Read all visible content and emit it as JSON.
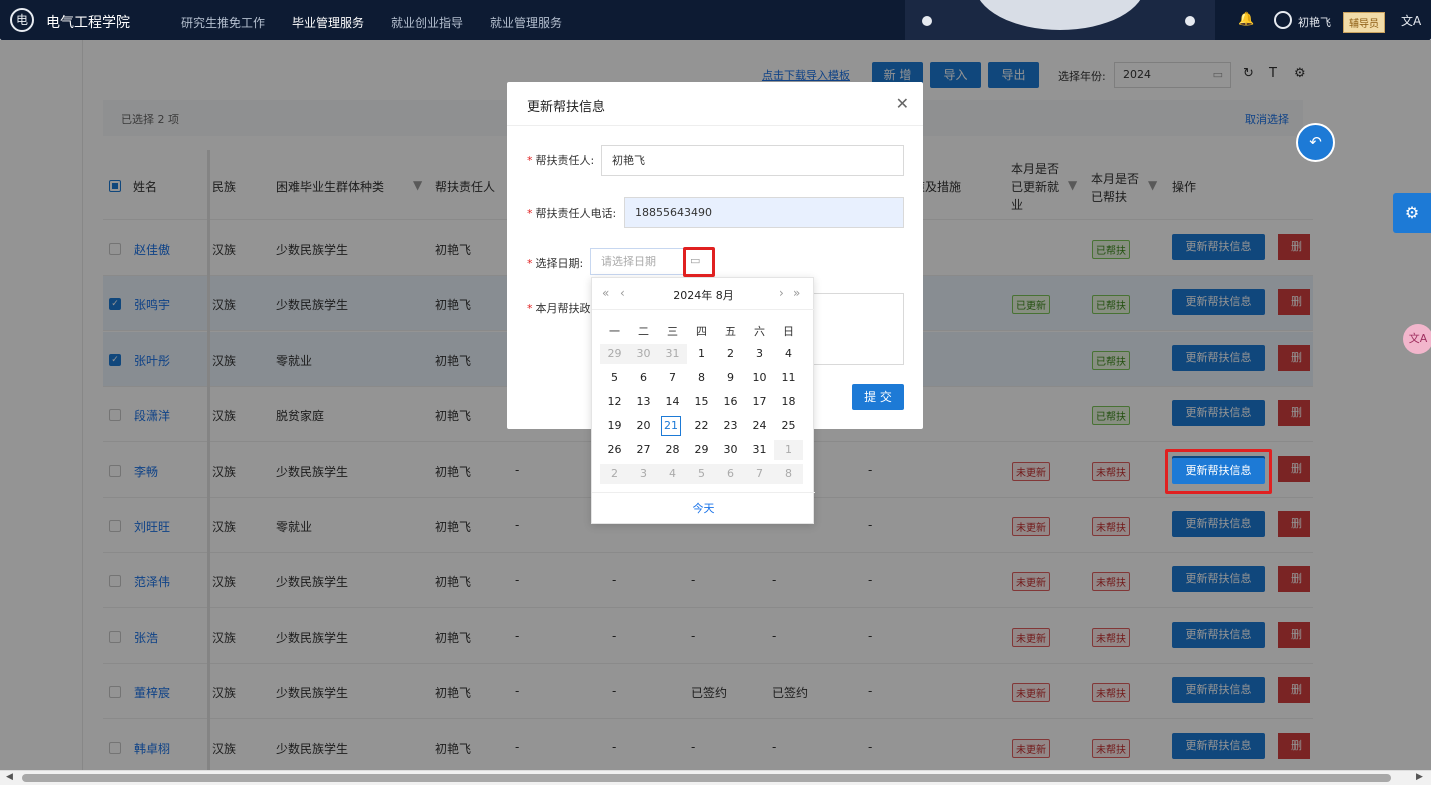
{
  "header": {
    "app_title": "电气工程学院",
    "logo_glyph": "电",
    "nav": [
      "研究生推免工作",
      "毕业管理服务",
      "就业创业指导",
      "就业管理服务"
    ],
    "active_nav_index": 1,
    "user_name": "初艳飞",
    "role_badge": "辅导员",
    "bell_glyph": "🔔",
    "lang_glyph": "文A"
  },
  "toolbar": {
    "download_template": "点击下载导入模板",
    "add_button": "新 增",
    "import_button": "导入",
    "export_button": "导出",
    "year_label": "选择年份:",
    "year_value": "2024",
    "refresh_glyph": "↻",
    "column_glyph": "T",
    "settings_glyph": "⚙"
  },
  "selection": {
    "selected_text": "已选择 2 项",
    "cancel_text": "取消选择"
  },
  "table": {
    "headers": {
      "name": "姓名",
      "ethnicity": "民族",
      "category": "困难毕业生群体种类",
      "responsible": "帮扶责任人",
      "measures": "策及措施",
      "updated": "本月是否已更新就业",
      "helped": "本月是否已帮扶",
      "actions": "操作"
    },
    "update_button": "更新帮扶信息",
    "delete_button": "删除",
    "rows": [
      {
        "name": "赵佳傲",
        "ethnicity": "汉族",
        "category": "少数民族学生",
        "responsible": "初艳飞",
        "c5": "",
        "c6": "",
        "c7": "",
        "c8": "",
        "c9": "",
        "updated": "",
        "helped": "已帮扶",
        "checked": false
      },
      {
        "name": "张鸣宇",
        "ethnicity": "汉族",
        "category": "少数民族学生",
        "responsible": "初艳飞",
        "c5": "",
        "c6": "",
        "c7": "",
        "c8": "",
        "c9": "",
        "updated": "已更新",
        "helped": "已帮扶",
        "checked": true
      },
      {
        "name": "张叶彤",
        "ethnicity": "汉族",
        "category": "零就业",
        "responsible": "初艳飞",
        "c5": "",
        "c6": "",
        "c7": "",
        "c8": "",
        "c9": "",
        "updated": "",
        "helped": "已帮扶",
        "checked": true
      },
      {
        "name": "段潇洋",
        "ethnicity": "汉族",
        "category": "脱贫家庭",
        "responsible": "初艳飞",
        "c5": "",
        "c6": "",
        "c7": "",
        "c8": "",
        "c9": "",
        "updated": "",
        "helped": "已帮扶",
        "checked": false
      },
      {
        "name": "李畅",
        "ethnicity": "汉族",
        "category": "少数民族学生",
        "responsible": "初艳飞",
        "c5": "-",
        "c6": "",
        "c7": "",
        "c8": "",
        "c9": "-",
        "updated": "未更新",
        "helped": "未帮扶",
        "checked": false
      },
      {
        "name": "刘旺旺",
        "ethnicity": "汉族",
        "category": "零就业",
        "responsible": "初艳飞",
        "c5": "-",
        "c6": "",
        "c7": "",
        "c8": "",
        "c9": "-",
        "updated": "未更新",
        "helped": "未帮扶",
        "checked": false
      },
      {
        "name": "范泽伟",
        "ethnicity": "汉族",
        "category": "少数民族学生",
        "responsible": "初艳飞",
        "c5": "-",
        "c6": "-",
        "c7": "-",
        "c8": "-",
        "c9": "-",
        "updated": "未更新",
        "helped": "未帮扶",
        "checked": false
      },
      {
        "name": "张浩",
        "ethnicity": "汉族",
        "category": "少数民族学生",
        "responsible": "初艳飞",
        "c5": "-",
        "c6": "-",
        "c7": "-",
        "c8": "-",
        "c9": "-",
        "updated": "未更新",
        "helped": "未帮扶",
        "checked": false
      },
      {
        "name": "董梓宸",
        "ethnicity": "汉族",
        "category": "少数民族学生",
        "responsible": "初艳飞",
        "c5": "-",
        "c6": "-",
        "c7": "已签约",
        "c8": "已签约",
        "c9": "-",
        "updated": "未更新",
        "helped": "未帮扶",
        "checked": false
      },
      {
        "name": "韩卓栩",
        "ethnicity": "汉族",
        "category": "少数民族学生",
        "responsible": "初艳飞",
        "c5": "-",
        "c6": "-",
        "c7": "-",
        "c8": "-",
        "c9": "-",
        "updated": "未更新",
        "helped": "未帮扶",
        "checked": false
      }
    ]
  },
  "modal": {
    "title": "更新帮扶信息",
    "close_glyph": "✕",
    "responsible_label": "帮扶责任人:",
    "responsible_value": "初艳飞",
    "phone_label": "帮扶责任人电话:",
    "phone_value": "18855643490",
    "date_label": "选择日期:",
    "date_placeholder": "请选择日期",
    "policy_label": "本月帮扶政",
    "submit_button": "提 交"
  },
  "datepicker": {
    "title": "2024年  8月",
    "prev_year": "«",
    "prev_month": "‹",
    "next_month": "›",
    "next_year": "»",
    "weekdays": [
      "一",
      "二",
      "三",
      "四",
      "五",
      "六",
      "日"
    ],
    "weeks": [
      [
        "29",
        "30",
        "31",
        "1",
        "2",
        "3",
        "4"
      ],
      [
        "5",
        "6",
        "7",
        "8",
        "9",
        "10",
        "11"
      ],
      [
        "12",
        "13",
        "14",
        "15",
        "16",
        "17",
        "18"
      ],
      [
        "19",
        "20",
        "21",
        "22",
        "23",
        "24",
        "25"
      ],
      [
        "26",
        "27",
        "28",
        "29",
        "30",
        "31",
        "1"
      ],
      [
        "2",
        "3",
        "4",
        "5",
        "6",
        "7",
        "8"
      ]
    ],
    "other_month_cells": [
      [
        0,
        0
      ],
      [
        0,
        1
      ],
      [
        0,
        2
      ],
      [
        4,
        6
      ],
      [
        5,
        0
      ],
      [
        5,
        1
      ],
      [
        5,
        2
      ],
      [
        5,
        3
      ],
      [
        5,
        4
      ],
      [
        5,
        5
      ],
      [
        5,
        6
      ]
    ],
    "today_cell": [
      3,
      2
    ],
    "today_link": "今天"
  },
  "floating": {
    "back_glyph": "↶",
    "gear_glyph": "⚙",
    "translate_glyph": "文A"
  },
  "colors": {
    "primary": "#1d7ad6",
    "danger": "#d23f3f",
    "header_bg": "#0d1b33",
    "highlight": "#e02020"
  }
}
